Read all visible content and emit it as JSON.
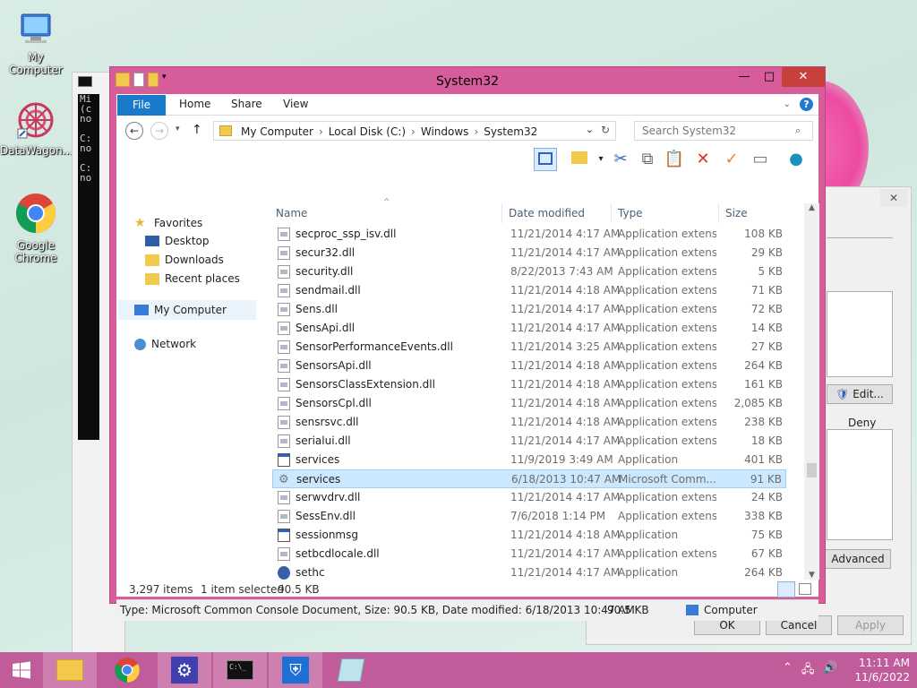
{
  "desktop": {
    "icons": [
      {
        "label": "My Computer"
      },
      {
        "label": "DataWagon..."
      },
      {
        "label": "Google Chrome"
      }
    ],
    "cmd_text": [
      "Mi",
      "(c",
      "no",
      "",
      "C:",
      "no",
      "",
      "C:",
      "no"
    ]
  },
  "properties_dialog": {
    "edit_label": "Edit...",
    "deny_label": "Deny",
    "advanced_label": "Advanced",
    "ok_label": "OK",
    "cancel_label": "Cancel",
    "apply_label": "Apply"
  },
  "window": {
    "title": "System32",
    "ribbon": {
      "file": "File",
      "home": "Home",
      "share": "Share",
      "view": "View"
    },
    "address": [
      "My Computer",
      "Local Disk (C:)",
      "Windows",
      "System32"
    ],
    "search_placeholder": "Search System32",
    "nav": {
      "favorites": "Favorites",
      "desktop": "Desktop",
      "downloads": "Downloads",
      "recent": "Recent places",
      "computer": "My Computer",
      "network": "Network"
    },
    "columns": {
      "name": "Name",
      "date": "Date modified",
      "type": "Type",
      "size": "Size"
    },
    "files": [
      {
        "name": "secproc_ssp_isv.dll",
        "date": "11/21/2014 4:17 AM",
        "type": "Application extens...",
        "size": "108 KB",
        "icon": "dll"
      },
      {
        "name": "secur32.dll",
        "date": "11/21/2014 4:17 AM",
        "type": "Application extens...",
        "size": "29 KB",
        "icon": "dll"
      },
      {
        "name": "security.dll",
        "date": "8/22/2013 7:43 AM",
        "type": "Application extens...",
        "size": "5 KB",
        "icon": "dll"
      },
      {
        "name": "sendmail.dll",
        "date": "11/21/2014 4:18 AM",
        "type": "Application extens...",
        "size": "71 KB",
        "icon": "dll"
      },
      {
        "name": "Sens.dll",
        "date": "11/21/2014 4:17 AM",
        "type": "Application extens...",
        "size": "72 KB",
        "icon": "dll"
      },
      {
        "name": "SensApi.dll",
        "date": "11/21/2014 4:17 AM",
        "type": "Application extens...",
        "size": "14 KB",
        "icon": "dll"
      },
      {
        "name": "SensorPerformanceEvents.dll",
        "date": "11/21/2014 3:25 AM",
        "type": "Application extens...",
        "size": "27 KB",
        "icon": "dll"
      },
      {
        "name": "SensorsApi.dll",
        "date": "11/21/2014 4:18 AM",
        "type": "Application extens...",
        "size": "264 KB",
        "icon": "dll"
      },
      {
        "name": "SensorsClassExtension.dll",
        "date": "11/21/2014 4:18 AM",
        "type": "Application extens...",
        "size": "161 KB",
        "icon": "dll"
      },
      {
        "name": "SensorsCpl.dll",
        "date": "11/21/2014 4:18 AM",
        "type": "Application extens...",
        "size": "2,085 KB",
        "icon": "dll"
      },
      {
        "name": "sensrsvc.dll",
        "date": "11/21/2014 4:18 AM",
        "type": "Application extens...",
        "size": "238 KB",
        "icon": "dll"
      },
      {
        "name": "serialui.dll",
        "date": "11/21/2014 4:17 AM",
        "type": "Application extens...",
        "size": "18 KB",
        "icon": "dll"
      },
      {
        "name": "services",
        "date": "11/9/2019 3:49 AM",
        "type": "Application",
        "size": "401 KB",
        "icon": "app"
      },
      {
        "name": "services",
        "date": "6/18/2013 10:47 AM",
        "type": "Microsoft Comm...",
        "size": "91 KB",
        "icon": "msc",
        "selected": true
      },
      {
        "name": "serwvdrv.dll",
        "date": "11/21/2014 4:17 AM",
        "type": "Application extens...",
        "size": "24 KB",
        "icon": "dll"
      },
      {
        "name": "SessEnv.dll",
        "date": "7/6/2018 1:14 PM",
        "type": "Application extens...",
        "size": "338 KB",
        "icon": "dll"
      },
      {
        "name": "sessionmsg",
        "date": "11/21/2014 4:18 AM",
        "type": "Application",
        "size": "75 KB",
        "icon": "app"
      },
      {
        "name": "setbcdlocale.dll",
        "date": "11/21/2014 4:17 AM",
        "type": "Application extens...",
        "size": "67 KB",
        "icon": "dll"
      },
      {
        "name": "sethc",
        "date": "11/21/2014 4:17 AM",
        "type": "Application",
        "size": "264 KB",
        "icon": "sethc"
      }
    ],
    "status": {
      "items": "3,297 items",
      "selected": "1 item selected",
      "selected_size": "90.5 KB"
    },
    "details": {
      "info": "Type: Microsoft Common Console Document, Size: 90.5 KB, Date modified: 6/18/2013 10:47 AM",
      "size": "90.5 KB",
      "location": "Computer"
    }
  },
  "taskbar": {
    "time": "11:11 AM",
    "date": "11/6/2022"
  }
}
